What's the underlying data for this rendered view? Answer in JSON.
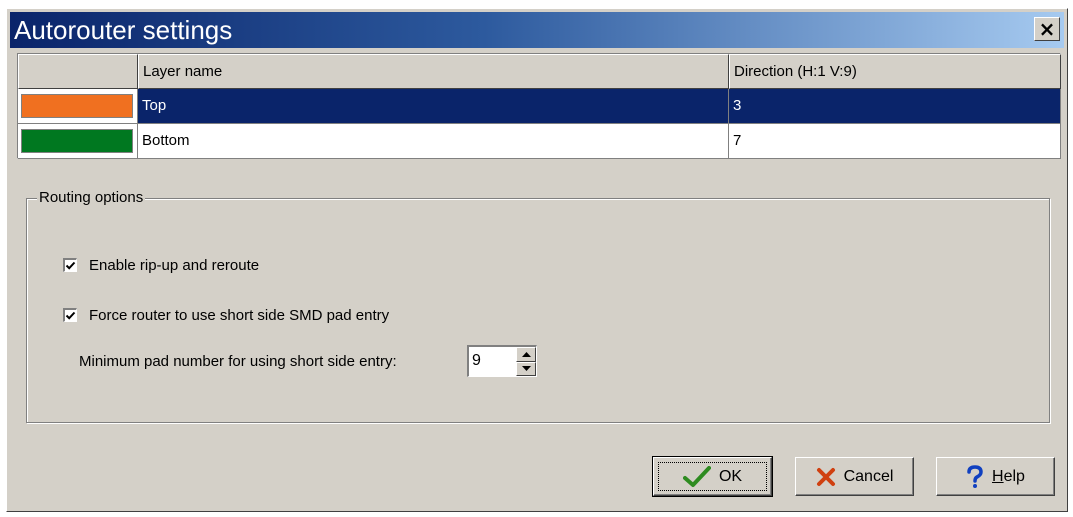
{
  "window": {
    "title": "Autorouter settings",
    "close_glyph": "×"
  },
  "layers": {
    "columns": [
      "",
      "Layer name",
      "Direction (H:1 V:9)"
    ],
    "rows": [
      {
        "color": "#f07020",
        "name": "Top",
        "direction": "3",
        "selected": true
      },
      {
        "color": "#007820",
        "name": "Bottom",
        "direction": "7",
        "selected": false
      }
    ]
  },
  "routing": {
    "group_label": "Routing options",
    "enable_ripup_label": "Enable rip-up and reroute",
    "enable_ripup_checked": true,
    "short_side_label": "Force router to use short side SMD pad entry",
    "short_side_checked": true,
    "min_pad_label": "Minimum pad number for using short side entry:",
    "min_pad_value": "9"
  },
  "buttons": {
    "ok": {
      "label": "OK",
      "icon": "check-icon"
    },
    "cancel": {
      "label": "Cancel",
      "icon": "cross-icon"
    },
    "help": {
      "label_prefix": "",
      "label_underlined": "H",
      "label_rest": "elp",
      "icon": "question-icon"
    }
  },
  "colors": {
    "titlebar_start": "#0a246a",
    "selection": "#0a246a",
    "dialog_face": "#d4d0c8"
  }
}
